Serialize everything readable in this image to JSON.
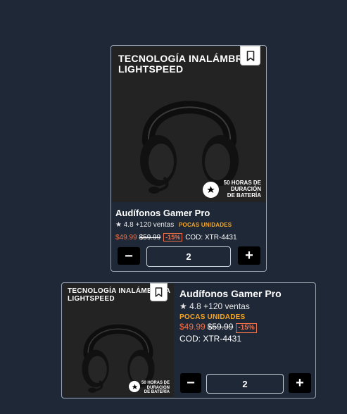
{
  "products": [
    {
      "layout": "vertical",
      "promo_title": "TECNOLOGÍA INALÁMBRICA\nLIGHTSPEED",
      "promo_sub": "50 HORAS DE\nDURACIÓN\nDE BATERÍA",
      "name": "Audífonos Gamer Pro",
      "star": "★",
      "rating": "4.8",
      "sales": "+120 ventas",
      "urgency": "POCAS UNIDADES",
      "price_new": "$49.99",
      "price_old": "$59.99",
      "discount": "-15%",
      "code": "COD: XTR-4431",
      "minus_label": "−",
      "plus_label": "+",
      "quantity": "2"
    },
    {
      "layout": "horizontal",
      "promo_title": "TECNOLOGÍA INALÁMBRICA\nLIGHTSPEED",
      "promo_sub": "50 HORAS DE\nDURACIÓN\nDE BATERÍA",
      "name": "Audífonos Gamer Pro",
      "star": "★",
      "rating": "4.8",
      "sales": "+120 ventas",
      "urgency": "POCAS UNIDADES",
      "price_new": "$49.99",
      "price_old": "$59.99",
      "discount": "-15%",
      "code": "COD: XTR-4431",
      "minus_label": "−",
      "plus_label": "+",
      "quantity": "2"
    }
  ],
  "icons": {
    "bookmark": "bookmark-icon",
    "brand": "brand-logo-icon",
    "product": "headset-image"
  },
  "colors": {
    "background": "#1f2837",
    "price_accent": "#f2724a",
    "urgency": "#f5a623",
    "button": "#000000"
  }
}
